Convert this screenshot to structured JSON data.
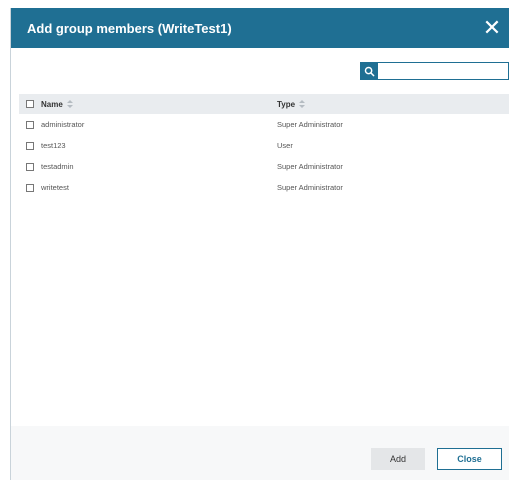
{
  "dialog": {
    "title": "Add group members (WriteTest1)",
    "close_icon": "close-icon"
  },
  "search": {
    "icon": "search-icon",
    "placeholder": "",
    "value": ""
  },
  "table": {
    "columns": [
      {
        "label": "Name"
      },
      {
        "label": "Type"
      }
    ],
    "rows": [
      {
        "name": "administrator",
        "type": "Super Administrator"
      },
      {
        "name": "test123",
        "type": "User"
      },
      {
        "name": "testadmin",
        "type": "Super Administrator"
      },
      {
        "name": "writetest",
        "type": "Super Administrator"
      }
    ]
  },
  "footer": {
    "add_label": "Add",
    "close_label": "Close"
  },
  "colors": {
    "accent": "#1f6f93",
    "header_bg": "#e9ecef"
  }
}
